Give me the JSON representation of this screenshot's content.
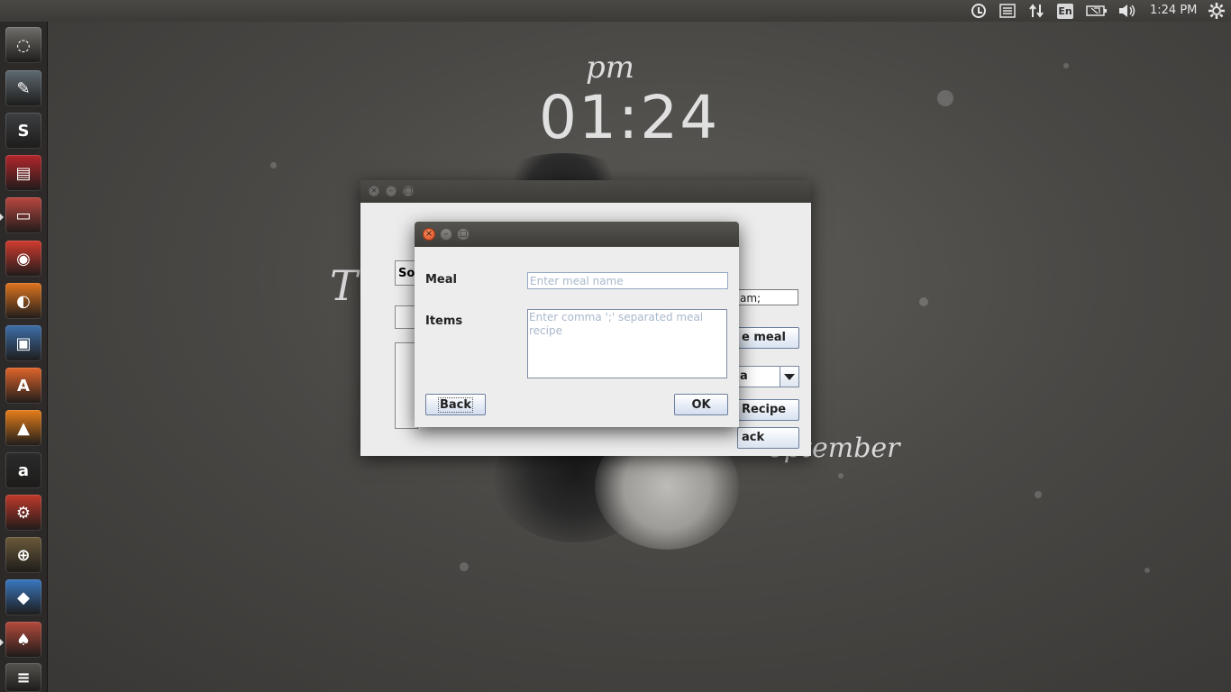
{
  "top_panel": {
    "icons": [
      "web-accounts-icon",
      "file-list-icon",
      "network-transfer-icon",
      "keyboard-layout-icon",
      "battery-icon",
      "volume-icon",
      "settings-gear-icon"
    ],
    "keyboard_layout": "En",
    "clock": "1:24 PM"
  },
  "launcher": {
    "items": [
      {
        "name": "ubuntu-dash",
        "glyph": "◌",
        "color": "#6f6e6a"
      },
      {
        "name": "text-editor",
        "glyph": "✎",
        "color": "#5f6a72"
      },
      {
        "name": "sublime-text",
        "glyph": "S",
        "color": "#3d3f42"
      },
      {
        "name": "terminal-app",
        "glyph": "▤",
        "color": "#b3262a"
      },
      {
        "name": "file-manager",
        "glyph": "▭",
        "color": "#b8473f"
      },
      {
        "name": "chrome-browser",
        "glyph": "◉",
        "color": "#d23b2f"
      },
      {
        "name": "firefox-browser",
        "glyph": "◐",
        "color": "#e0751f"
      },
      {
        "name": "image-viewer",
        "glyph": "▣",
        "color": "#3d6fa8"
      },
      {
        "name": "software-center",
        "glyph": "A",
        "color": "#e0652b"
      },
      {
        "name": "vlc-player",
        "glyph": "▲",
        "color": "#e67e1a"
      },
      {
        "name": "amazon-app",
        "glyph": "a",
        "color": "#2b2b2b"
      },
      {
        "name": "system-tools",
        "glyph": "⚙",
        "color": "#c0392b"
      },
      {
        "name": "disk-utility",
        "glyph": "⊕",
        "color": "#6b5a3a"
      },
      {
        "name": "virtualbox-app",
        "glyph": "◆",
        "color": "#3a78c0"
      },
      {
        "name": "java-app",
        "glyph": "♠",
        "color": "#b44a3c"
      },
      {
        "name": "workspace-switcher",
        "glyph": "≡",
        "color": "#55534f"
      }
    ]
  },
  "wallpaper": {
    "ampm": "pm",
    "time": "01:24",
    "weekday_partial": "T",
    "month_partial": "eptember"
  },
  "background_window": {
    "partial_label_so": "So",
    "field_partial_value": "am;",
    "button_meal_partial": "e meal",
    "combo_partial_value": "a",
    "button_recipe_partial": "Recipe",
    "button_back_partial": "ack"
  },
  "dialog": {
    "meal_label": "Meal",
    "meal_placeholder": "Enter meal name",
    "meal_value": "",
    "items_label": "Items",
    "items_placeholder": "Enter comma ';' separated meal recipe",
    "items_value": "",
    "back_label": "Back",
    "ok_label": "OK"
  }
}
